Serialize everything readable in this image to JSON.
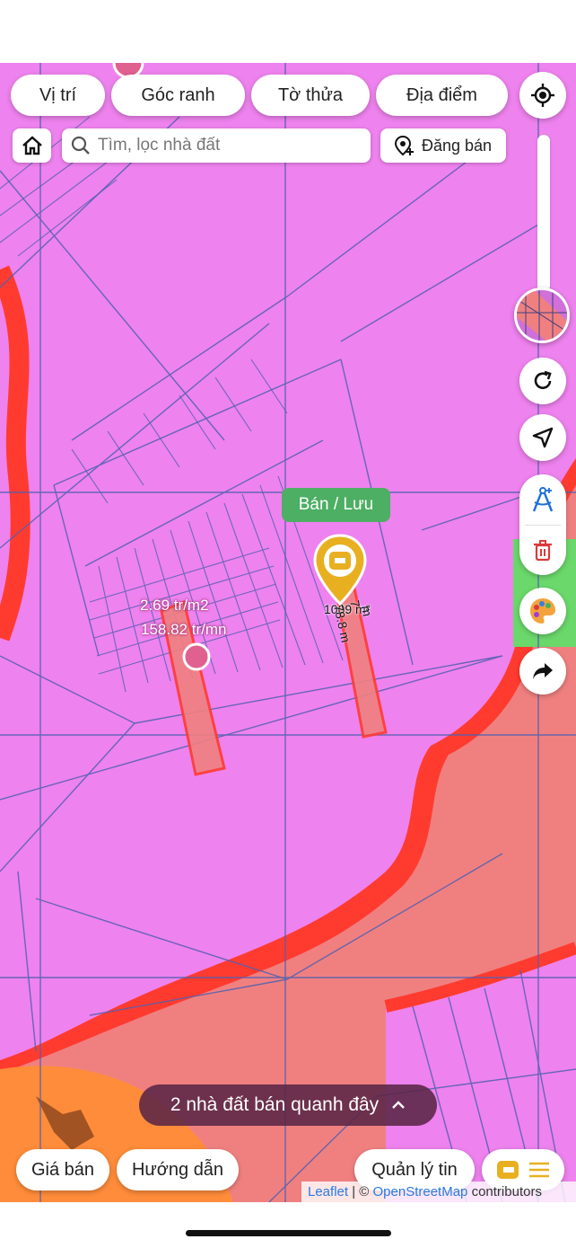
{
  "top_filters": [
    {
      "label": "Vị trí"
    },
    {
      "label": "Góc ranh"
    },
    {
      "label": "Tờ thửa"
    },
    {
      "label": "Địa điểm"
    }
  ],
  "search": {
    "placeholder": "Tìm, lọc nhà đất"
  },
  "post_button": {
    "label": "Đăng bán"
  },
  "map": {
    "listing_price_per_m2": "2.69 tr/m2",
    "listing_price_total": "158.82 tr/mn",
    "parcel_area": "1009 m²",
    "parcel_side_a": "7",
    "parcel_side_b": "m",
    "parcel_length": "78.8 m",
    "sell_save_tag": "Bán / Lưu",
    "colors": {
      "residential": "#ee82ee",
      "road_buffer": "#ff3b30",
      "road": "#f08080",
      "agri": "#ff8c3a",
      "green": "#6bd86b",
      "sell_tag": "#4caf63"
    }
  },
  "nearby": {
    "label": "2 nhà đất bán quanh đây"
  },
  "bottom": {
    "price": "Giá bán",
    "guide": "Hướng dẫn",
    "manage": "Quản lý tin"
  },
  "attribution": {
    "leaflet": "Leaflet",
    "sep": " | © ",
    "osm": "OpenStreetMap",
    "contrib": " contributors"
  }
}
